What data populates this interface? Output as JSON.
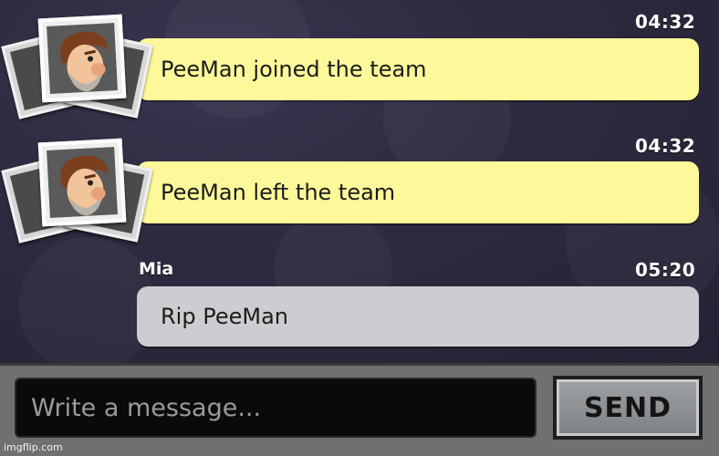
{
  "messages": [
    {
      "type": "system",
      "time": "04:32",
      "text": "PeeMan joined the team",
      "icon": "player-avatar-icon"
    },
    {
      "type": "system",
      "time": "04:32",
      "text": "PeeMan left the team",
      "icon": "player-avatar-icon"
    },
    {
      "type": "user",
      "sender": "Mia",
      "time": "05:20",
      "text": "Rip PeeMan"
    }
  ],
  "composer": {
    "placeholder": "Write a message...",
    "send_label": "SEND"
  },
  "watermark": "imgflip.com",
  "colors": {
    "system_bubble": "#fdf99a",
    "user_bubble": "#cdcdd1",
    "background": "#2e2a40",
    "input_bar": "#707070"
  }
}
